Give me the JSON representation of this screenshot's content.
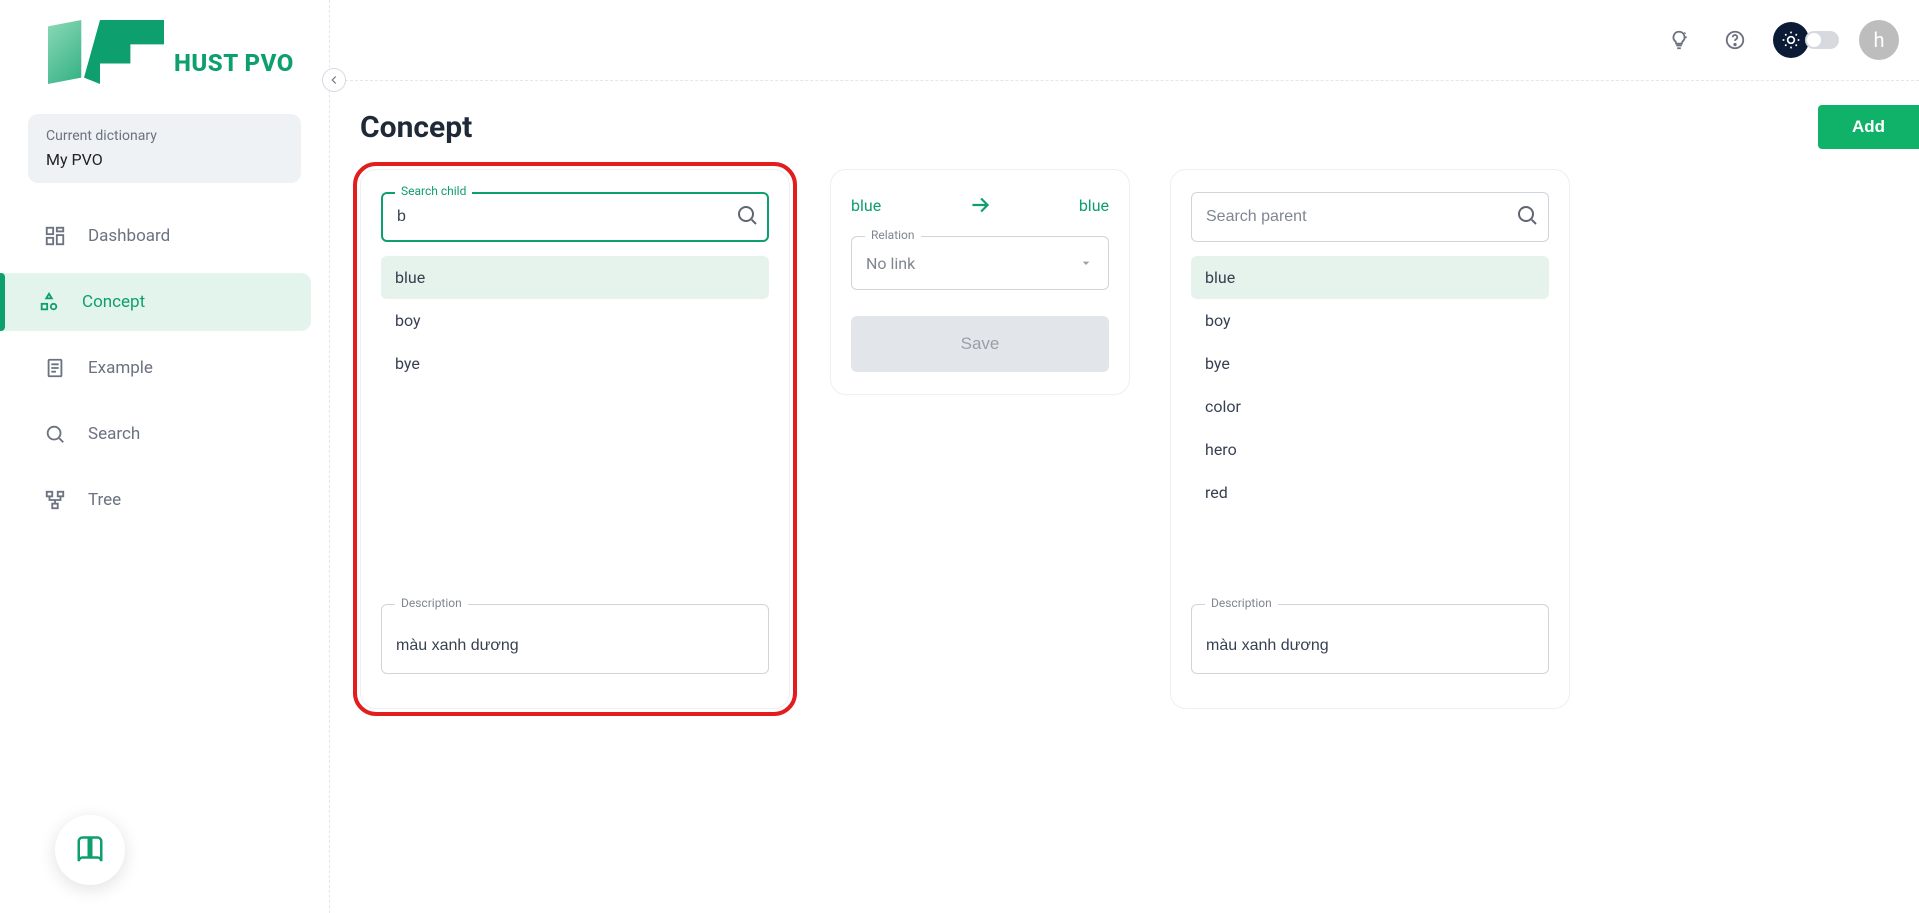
{
  "app": {
    "logo_text": "HUST PVO",
    "avatar_letter": "h"
  },
  "sidebar": {
    "current_label": "Current dictionary",
    "current_value": "My PVO",
    "items": [
      {
        "label": "Dashboard"
      },
      {
        "label": "Concept"
      },
      {
        "label": "Example"
      },
      {
        "label": "Search"
      },
      {
        "label": "Tree"
      }
    ]
  },
  "page": {
    "title": "Concept",
    "add_label": "Add"
  },
  "child_card": {
    "search_label": "Search child",
    "search_value": "b",
    "items": [
      "blue",
      "boy",
      "bye"
    ],
    "selected": "blue",
    "description_label": "Description",
    "description_value": "màu xanh dương"
  },
  "middle_card": {
    "left": "blue",
    "right": "blue",
    "relation_label": "Relation",
    "relation_value": "No link",
    "save_label": "Save"
  },
  "parent_card": {
    "search_placeholder": "Search parent",
    "items": [
      "blue",
      "boy",
      "bye",
      "color",
      "hero",
      "red"
    ],
    "selected": "blue",
    "description_label": "Description",
    "description_value": "màu xanh dương"
  }
}
